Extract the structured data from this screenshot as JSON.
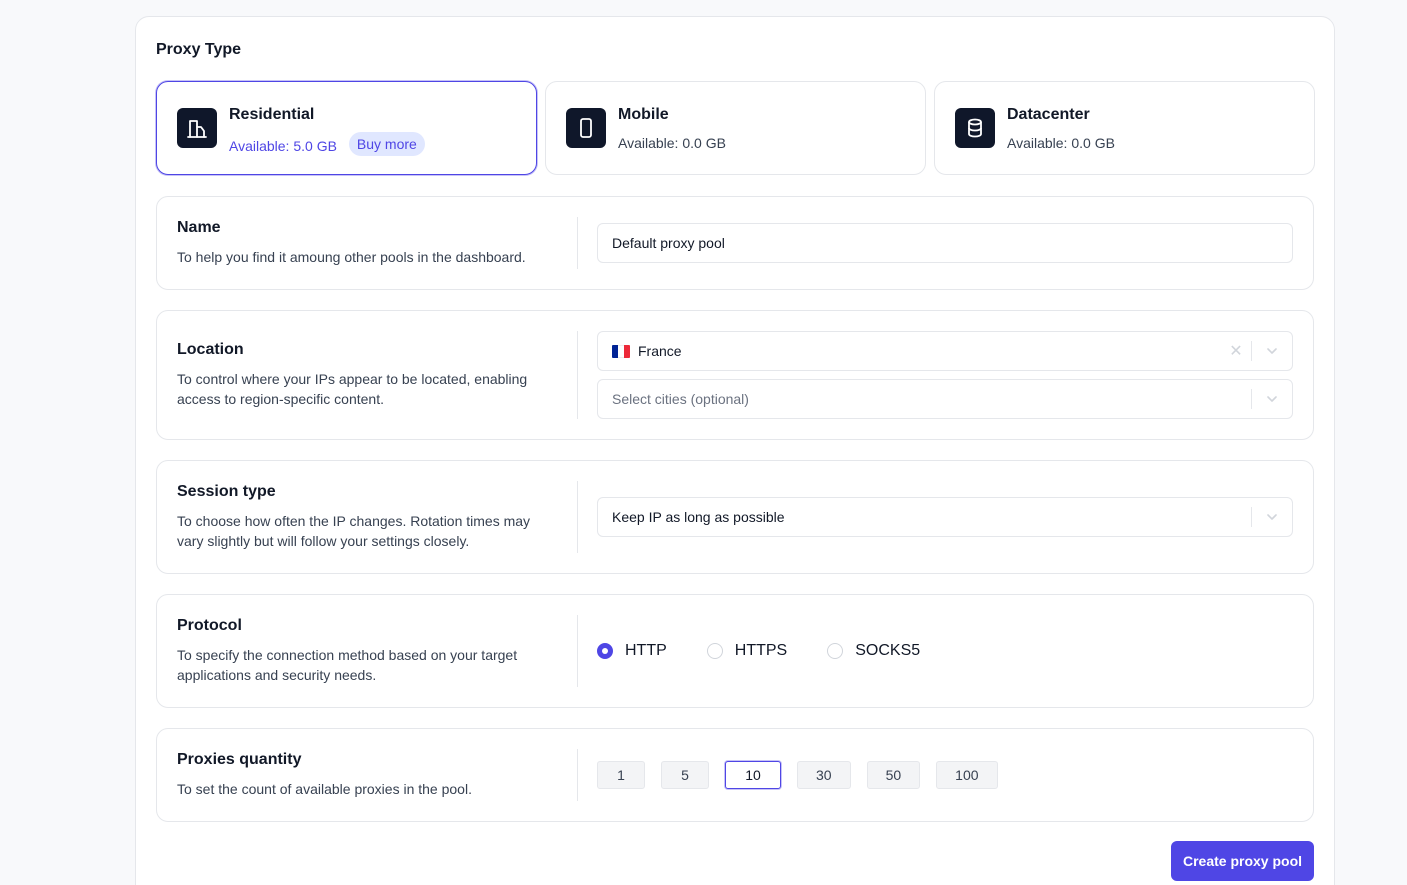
{
  "proxy_type": {
    "title": "Proxy Type",
    "options": [
      {
        "name": "Residential",
        "available": "Available: 5.0 GB",
        "buy_more": "Buy more",
        "icon": "building-icon",
        "selected": true
      },
      {
        "name": "Mobile",
        "available": "Available: 0.0 GB",
        "icon": "smartphone-icon",
        "selected": false
      },
      {
        "name": "Datacenter",
        "available": "Available: 0.0 GB",
        "icon": "database-icon",
        "selected": false
      }
    ]
  },
  "name_section": {
    "label": "Name",
    "description": "To help you find it amoung other pools in the dashboard.",
    "value": "Default proxy pool"
  },
  "location_section": {
    "label": "Location",
    "description": "To control where your IPs appear to be located, enabling access to region-specific content.",
    "country": "France",
    "country_flag_colors": [
      "#002395",
      "#ffffff",
      "#ed2939"
    ],
    "cities_placeholder": "Select cities (optional)"
  },
  "session_section": {
    "label": "Session type",
    "description": "To choose how often the IP changes. Rotation times may vary slightly but will follow your settings closely.",
    "value": "Keep IP as long as possible"
  },
  "protocol_section": {
    "label": "Protocol",
    "description": "To specify the connection method based on your target applications and security needs.",
    "options": [
      "HTTP",
      "HTTPS",
      "SOCKS5"
    ],
    "selected": "HTTP"
  },
  "quantity_section": {
    "label": "Proxies quantity",
    "description": "To set the count of available proxies in the pool.",
    "options": [
      "1",
      "5",
      "10",
      "30",
      "50",
      "100"
    ],
    "selected": "10"
  },
  "actions": {
    "create_label": "Create proxy pool"
  },
  "colors": {
    "accent": "#4f46e5",
    "accent_light": "#e0e7ff",
    "icon_bg": "#0f172a",
    "border": "#e5e7eb"
  }
}
